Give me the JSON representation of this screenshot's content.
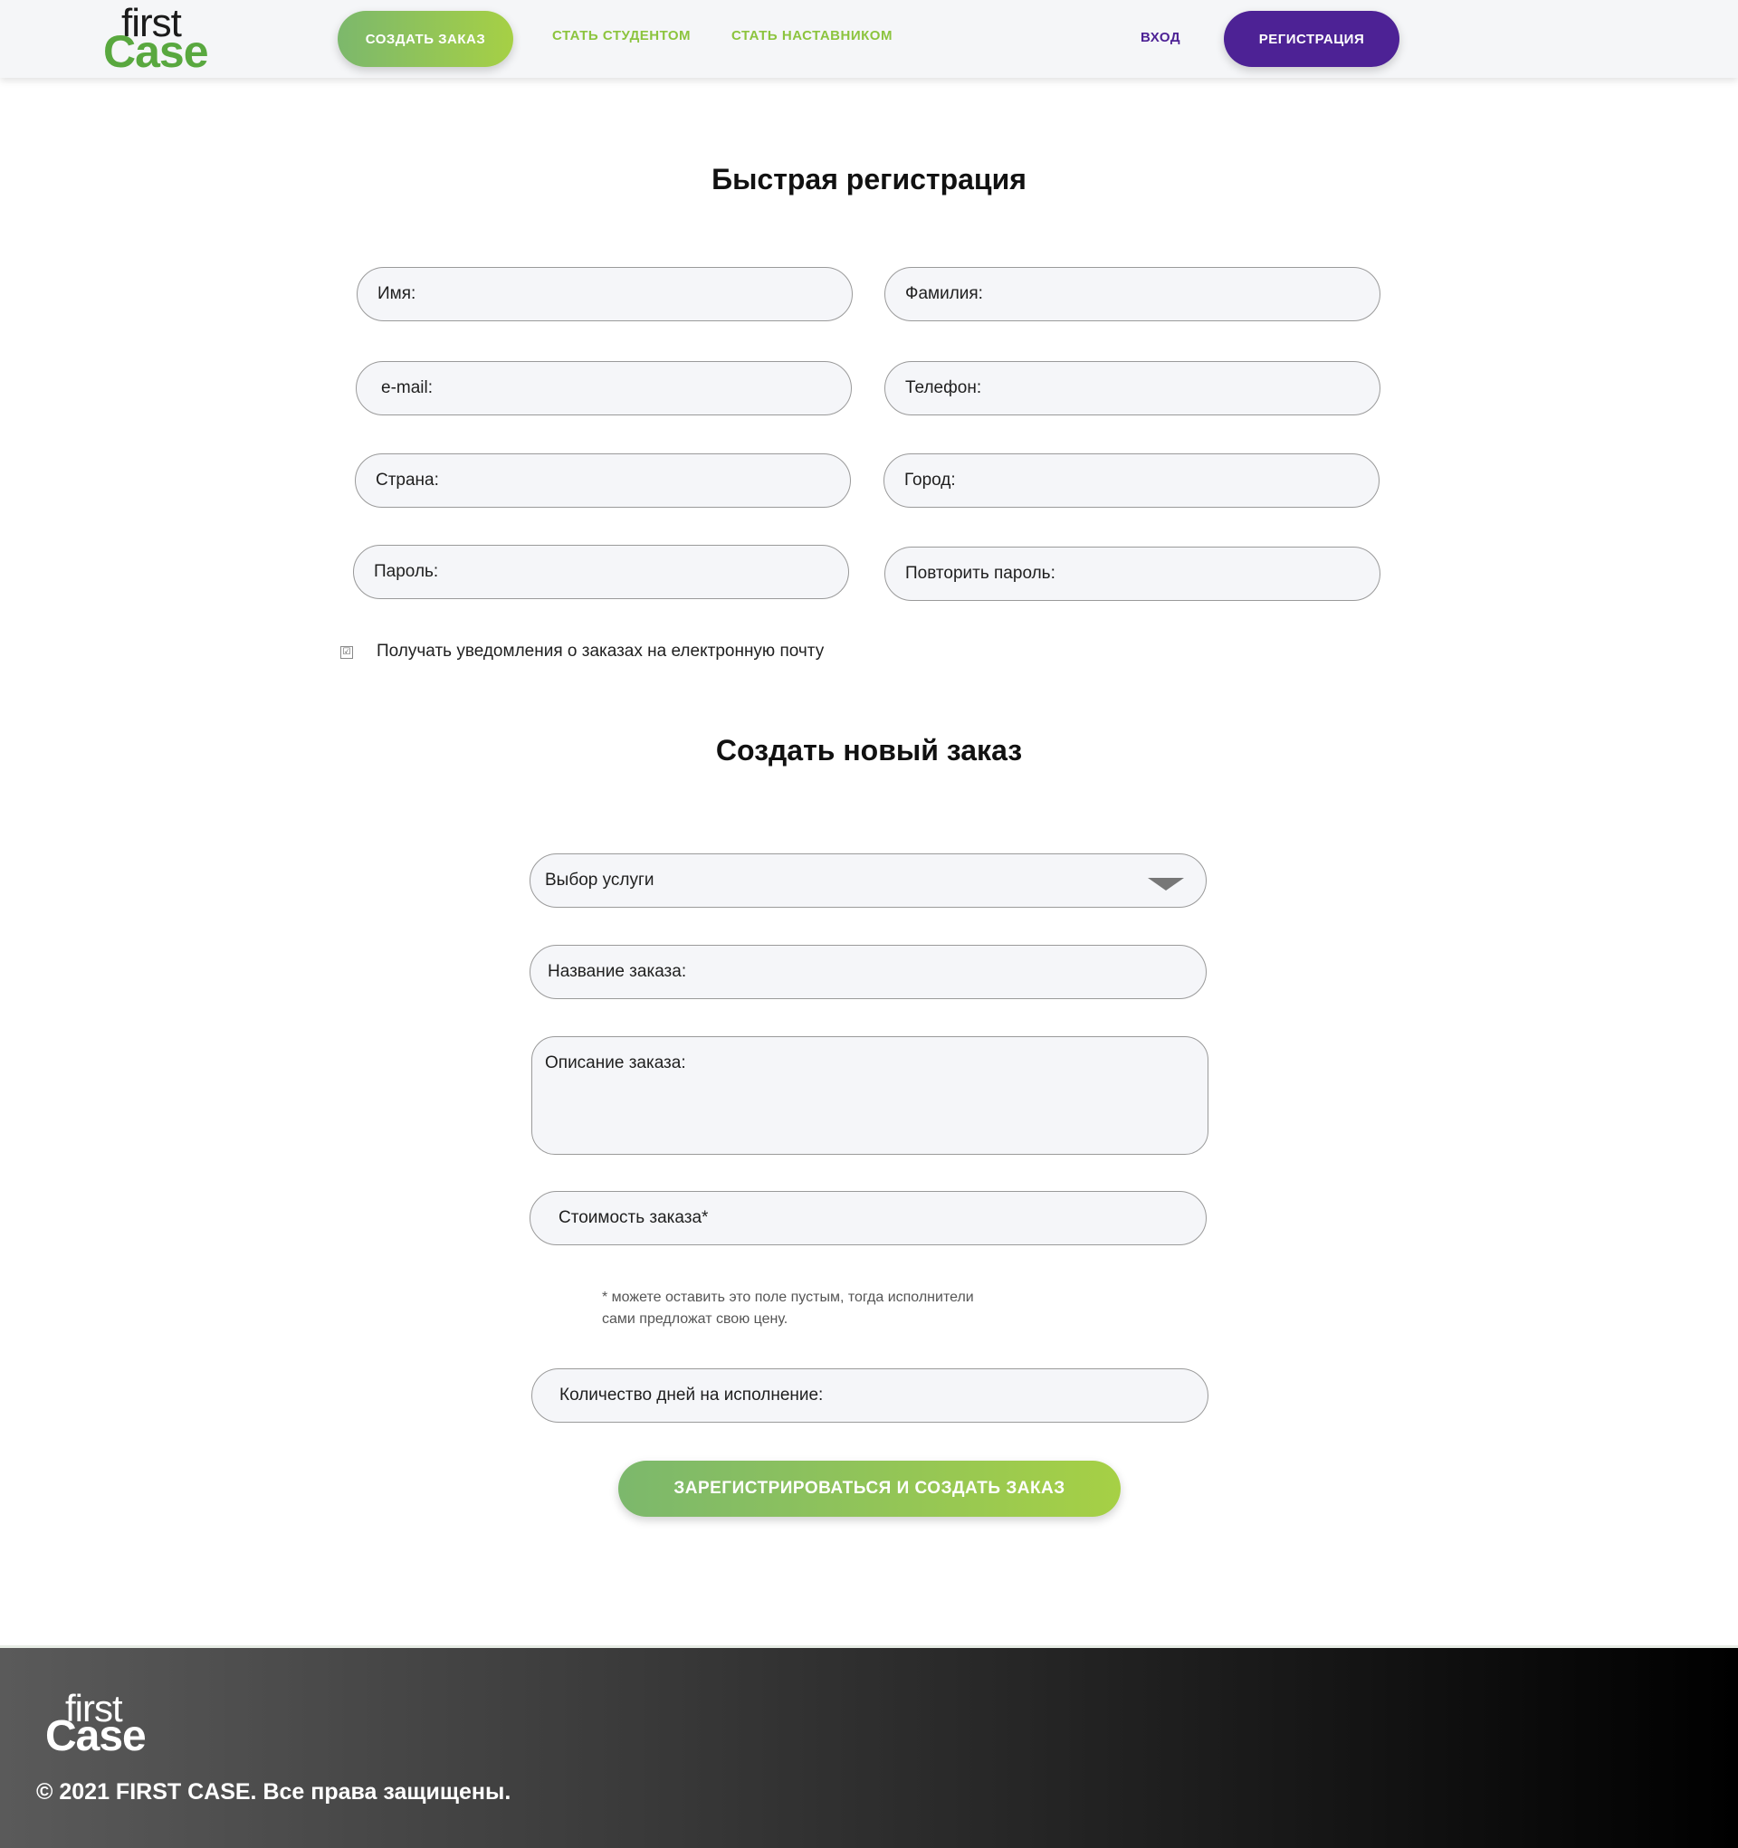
{
  "header": {
    "logo_first": "first",
    "logo_case": "Case",
    "create_order": "СОЗДАТЬ ЗАКАЗ",
    "become_student": "СТАТЬ СТУДЕНТОМ",
    "become_mentor": "СТАТЬ НАСТАВНИКОМ",
    "login": "ВХОД",
    "register": "РЕГИСТРАЦИЯ"
  },
  "registration": {
    "title": "Быстрая регистрация",
    "first_name": "Имя:",
    "last_name": "Фамилия:",
    "email": "e-mail:",
    "phone": "Телефон:",
    "country": "Страна:",
    "city": "Город:",
    "password": "Пароль:",
    "repeat_password": "Повторить пароль:",
    "notify_checked": true,
    "notify_label": "Получать уведомления о заказах на електронную почту"
  },
  "order": {
    "title": "Создать новый заказ",
    "service_select": "Выбор услуги",
    "order_name": "Название заказа:",
    "order_description": "Описание заказа:",
    "order_price": "Стоимость заказа*",
    "price_hint_line1": "* можете оставить это поле пустым, тогда исполнители",
    "price_hint_line2": "сами предложат свою цену.",
    "days": "Количество дней на исполнение:",
    "submit": "ЗАРЕГИСТРИРОВАТЬСЯ И СОЗДАТЬ ЗАКАЗ"
  },
  "footer": {
    "logo_first": "first",
    "logo_case": "Case",
    "copyright": "© 2021 FIRST CASE. Все права защищены."
  },
  "colors": {
    "brand_green": "#8cc43e",
    "brand_purple": "#4d2295",
    "check_mark": "☑"
  }
}
